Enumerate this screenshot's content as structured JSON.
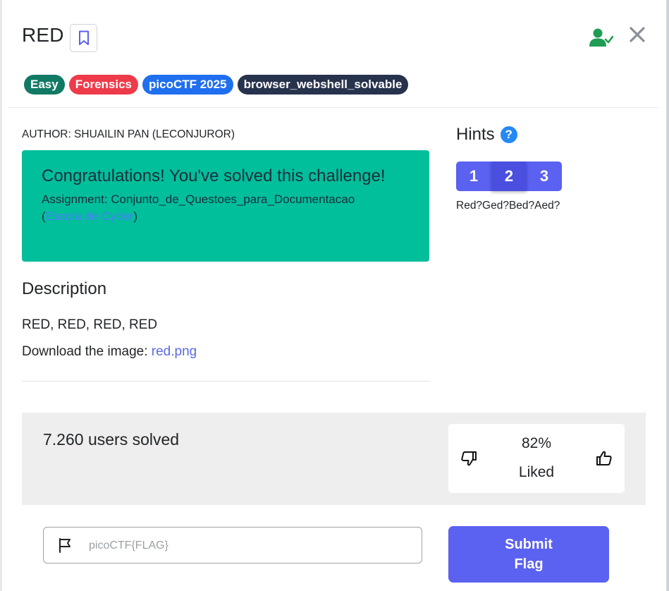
{
  "header": {
    "title": "RED",
    "bookmark_icon": "bookmark-icon",
    "user_status_icon": "user-check-icon",
    "close_icon": "close-icon"
  },
  "tags": [
    {
      "label": "Easy",
      "color": "#117a65"
    },
    {
      "label": "Forensics",
      "color": "#ee3b4a"
    },
    {
      "label": "picoCTF 2025",
      "color": "#1f6fef"
    },
    {
      "label": "browser_webshell_solvable",
      "color": "#27324c"
    }
  ],
  "author": "AUTHOR: SHUAILIN PAN (LECONJUROR)",
  "congrats": {
    "title": "Congratulations! You've solved this challenge!",
    "assignment_prefix": "Assignment: Conjunto_de_Questoes_para_Documentacao",
    "paren_open": "(",
    "assignment_link": "Escola de Cyber",
    "paren_close": ")",
    "bg_color": "#00bf9a"
  },
  "description": {
    "heading": "Description",
    "line1": "RED, RED, RED, RED",
    "download_prefix": "Download the image:",
    "download_link": "red.png"
  },
  "hints": {
    "heading": "Hints",
    "help_icon": "question-circle-icon",
    "help_glyph": "?",
    "buttons": [
      "1",
      "2",
      "3"
    ],
    "active": "2",
    "text": "Red?Ged?Bed?Aed?"
  },
  "stats": {
    "solved": "7.260 users solved",
    "liked_percent": "82%",
    "liked_label": "Liked",
    "thumbs_down_icon": "thumbs-down-icon",
    "thumbs_up_icon": "thumbs-up-icon"
  },
  "flag": {
    "icon": "flag-icon",
    "placeholder": "picoCTF{FLAG}",
    "value": "",
    "submit_label": "Submit Flag"
  },
  "colors": {
    "accent": "#5b61f0",
    "success": "#00bf9a",
    "link": "#5a6ae8"
  }
}
